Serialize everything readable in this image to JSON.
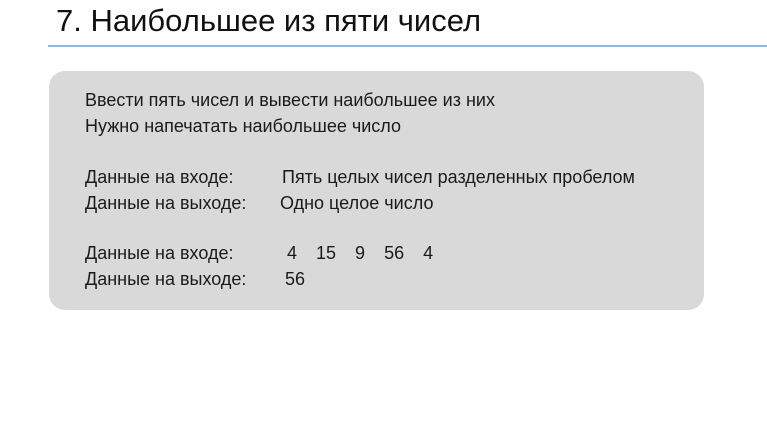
{
  "title": "7. Наибольшее из пяти чисел",
  "task": {
    "description_line1": "Ввести пять чисел и  вывести наибольшее из них",
    "description_line2": "Нужно напечатать наибольшее число",
    "input_label": "Данные на входе:",
    "input_spec": "Пять целых чисел разделенных пробелом",
    "output_label": "Данные на выходе:",
    "output_spec": "Одно целое число",
    "example_input_label": "Данные на входе:",
    "example_input_values": [
      "4",
      "15",
      "9",
      "56",
      "4"
    ],
    "example_output_label": "Данные на выходе:",
    "example_output_value": "56"
  },
  "colors": {
    "accent_rule": "#8eb6e6",
    "card_background": "#d9d9d9"
  }
}
